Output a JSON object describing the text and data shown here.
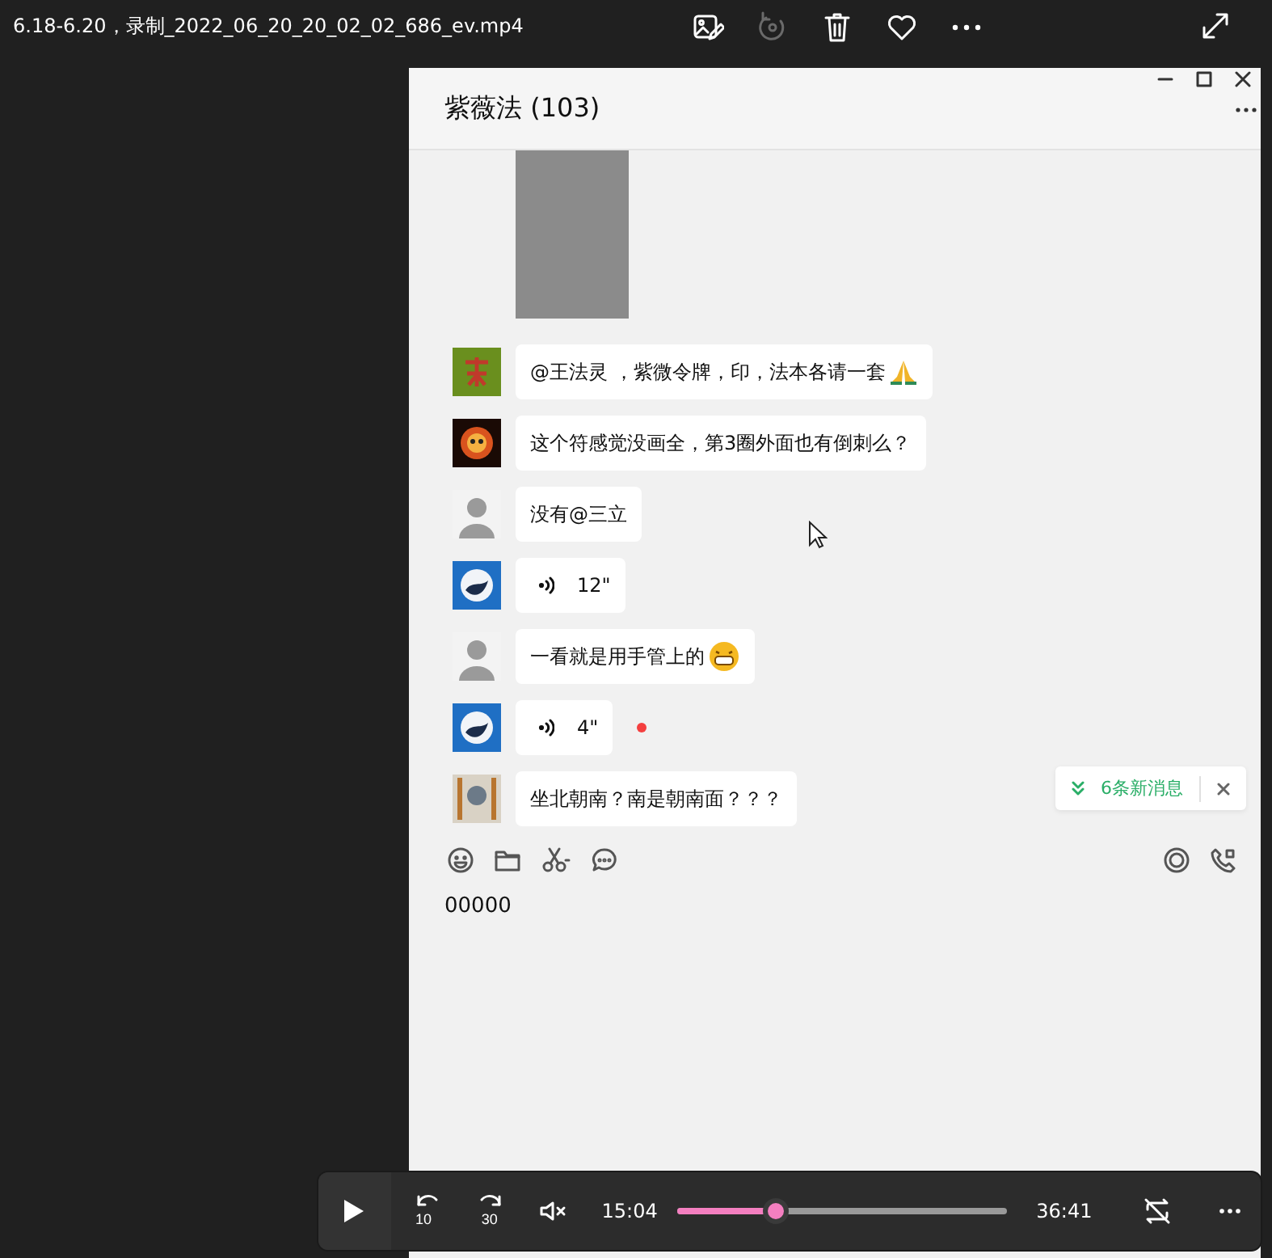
{
  "window": {
    "title": "6.18-6.20，录制_2022_06_20_20_02_02_686_ev.mp4"
  },
  "toolbar": [
    {
      "kind": "edit",
      "disabled": false
    },
    {
      "kind": "rotate",
      "disabled": true
    },
    {
      "kind": "delete",
      "disabled": false
    },
    {
      "kind": "favorite",
      "disabled": false
    },
    {
      "kind": "more",
      "disabled": false
    }
  ],
  "chat": {
    "title": "紫薇法 (103)",
    "messages": [
      {
        "kind": "image"
      },
      {
        "kind": "text",
        "text": "@王法灵 ，紫微令牌，印，法本各请一套"
      },
      {
        "kind": "text",
        "text": "这个符感觉没画全，第3圈外面也有倒刺么？"
      },
      {
        "kind": "text",
        "text": "没有@三立"
      },
      {
        "kind": "voice",
        "duration": "12\"",
        "unread": false
      },
      {
        "kind": "text",
        "text": "一看就是用手管上的"
      },
      {
        "kind": "voice",
        "duration": "4\"",
        "unread": true
      },
      {
        "kind": "text",
        "text": "坐北朝南？南是朝南面？？？"
      }
    ],
    "new_messages": "6条新消息",
    "input": {
      "value": "00000"
    }
  },
  "player": {
    "playing": false,
    "rewind": "10",
    "forward": "30",
    "muted": true,
    "elapsed": "15:04",
    "level": 0.3,
    "total": "36:41",
    "repeat": false
  }
}
